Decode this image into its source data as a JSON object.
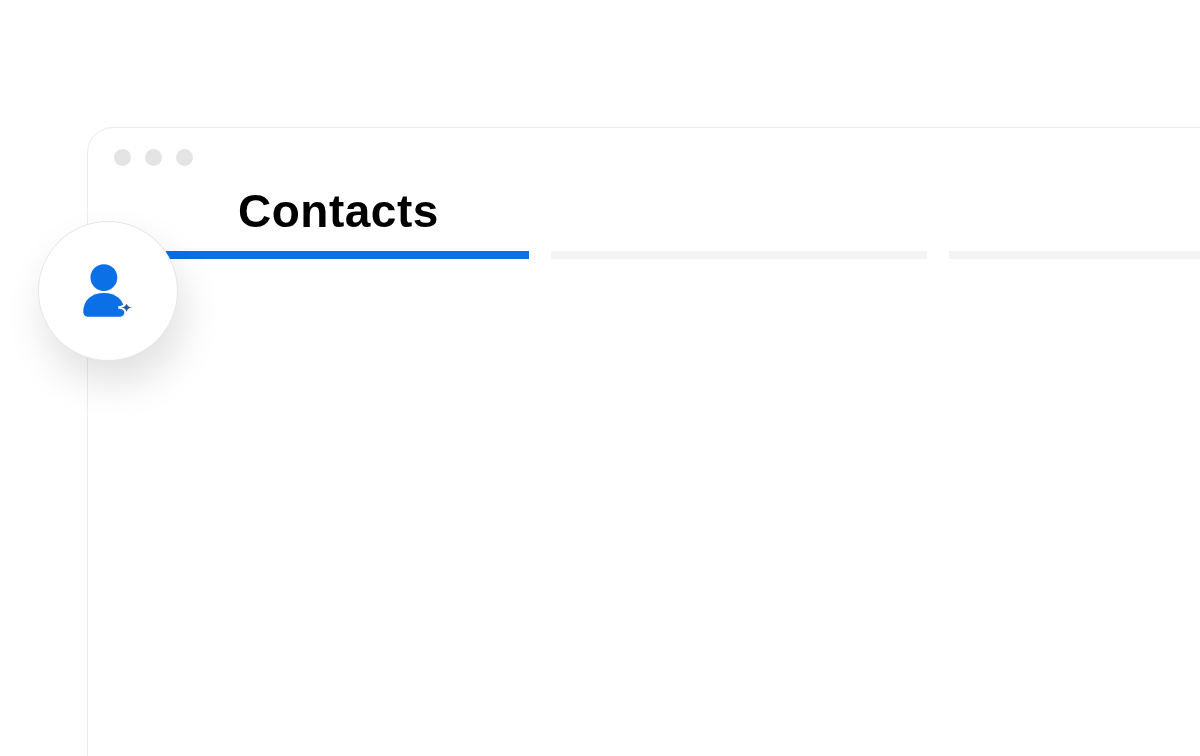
{
  "window": {
    "title": "Contacts"
  },
  "progress_segments": [
    {
      "level": 1
    },
    {
      "level": 0
    },
    {
      "level": 0
    }
  ]
}
